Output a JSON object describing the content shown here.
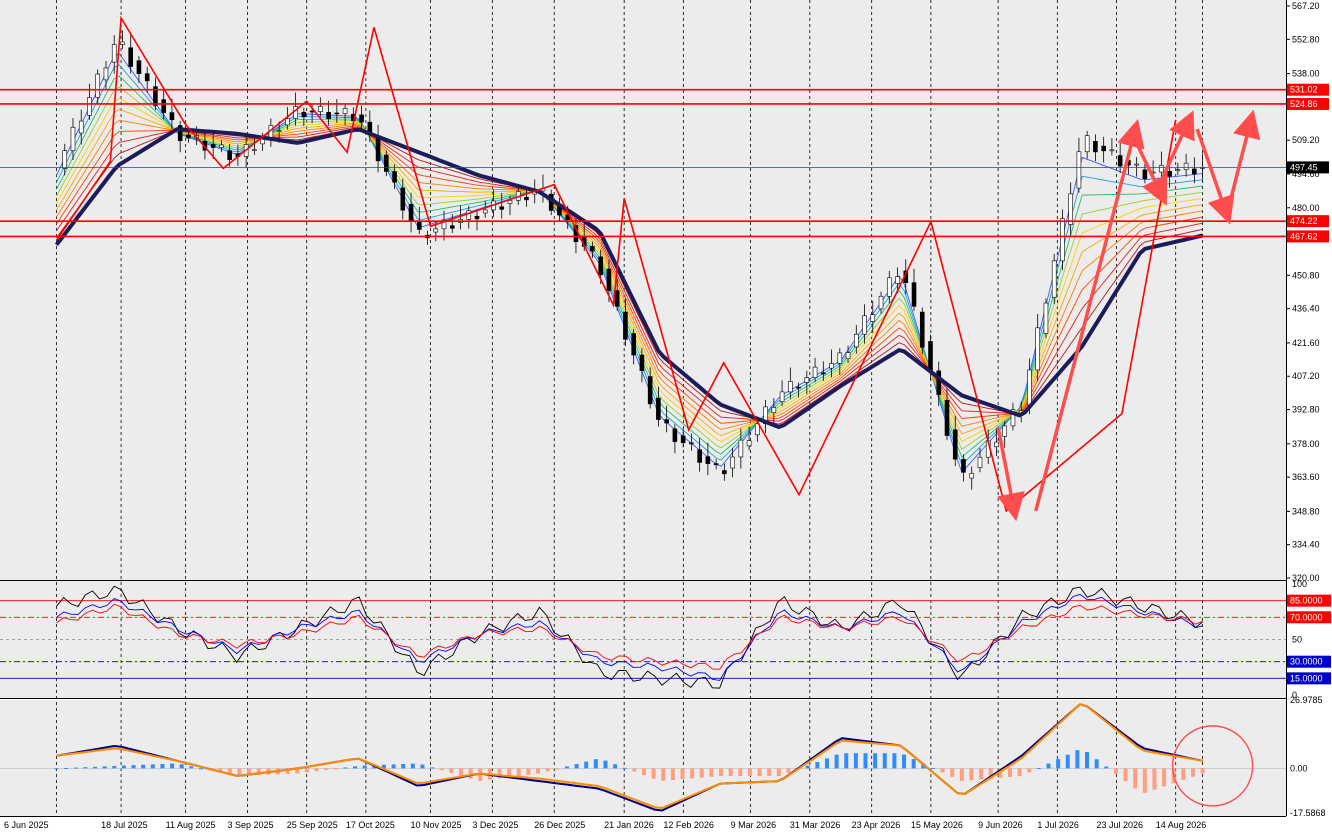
{
  "chart_data": [
    {
      "type": "candlestick",
      "panel": "price",
      "series": [
        {
          "name": "",
          "kind": "candles",
          "x": [
            "2025-06-24",
            "2025-07-18",
            "2025-08-11",
            "2025-09-03",
            "2025-09-25",
            "2025-10-17",
            "2025-11-10",
            "2025-12-03",
            "2025-12-26",
            "2026-01-21",
            "2026-02-12",
            "2026-03-09",
            "2026-03-31",
            "2026-04-23",
            "2026-05-15",
            "2026-06-09",
            "2026-07-01",
            "2026-07-23",
            "2026-08-14",
            "2026-08-24"
          ],
          "close": [
            497,
            553,
            512,
            502,
            522,
            520,
            468,
            478,
            488,
            455,
            387,
            365,
            400,
            415,
            455,
            362,
            395,
            510,
            495,
            497.45
          ]
        },
        {
          "name": "",
          "kind": "line",
          "color": "#1c1c5a",
          "values": [
            464,
            498,
            514,
            512,
            508,
            514,
            504,
            494,
            487,
            470,
            417,
            395,
            385,
            403,
            419,
            399,
            390,
            420,
            462,
            468
          ]
        }
      ],
      "xlabels": [
        "6 Jun 2025",
        "18 Jul 2025",
        "11 Aug 2025",
        "3 Sep 2025",
        "25 Sep 2025",
        "17 Oct 2025",
        "10 Nov 2025",
        "3 Dec 2025",
        "26 Dec 2025",
        "21 Jan 2026",
        "12 Feb 2026",
        "9 Mar 2026",
        "31 Mar 2026",
        "23 Apr 2026",
        "15 May 2026",
        "9 Jun 2026",
        "1 Jul 2026",
        "23 Jul 2026",
        "14 Aug 2026"
      ],
      "yticks": [
        "567.20",
        "552.80",
        "538.00",
        "509.20",
        "494.60",
        "480.00",
        "450.80",
        "436.40",
        "421.60",
        "407.20",
        "392.80",
        "378.00",
        "363.60",
        "348.80",
        "334.40",
        "320.00"
      ],
      "ylim": [
        320,
        567.2
      ],
      "hlines": [
        {
          "value": 531.02,
          "label": "531.02",
          "color": "#ff0000"
        },
        {
          "value": 524.86,
          "label": "524.86",
          "color": "#ff0000"
        },
        {
          "value": 497.45,
          "label": "497.45",
          "color": "#1f3fd0"
        },
        {
          "value": 474.22,
          "label": "474.22",
          "color": "#ff0000"
        },
        {
          "value": 467.62,
          "label": "467.62",
          "color": "#ff0000"
        }
      ],
      "zigzag": [
        {
          "x": "2025-06-24",
          "y": 466
        },
        {
          "x": "2025-07-14",
          "y": 500
        },
        {
          "x": "2025-07-18",
          "y": 562
        },
        {
          "x": "2025-08-11",
          "y": 516
        },
        {
          "x": "2025-08-25",
          "y": 497
        },
        {
          "x": "2025-09-25",
          "y": 526
        },
        {
          "x": "2025-10-10",
          "y": 504
        },
        {
          "x": "2025-10-20",
          "y": 558
        },
        {
          "x": "2025-11-10",
          "y": 472
        },
        {
          "x": "2025-12-26",
          "y": 490
        },
        {
          "x": "2026-01-17",
          "y": 438
        },
        {
          "x": "2026-01-21",
          "y": 484
        },
        {
          "x": "2026-02-14",
          "y": 384
        },
        {
          "x": "2026-02-27",
          "y": 413
        },
        {
          "x": "2026-03-27",
          "y": 356
        },
        {
          "x": "2026-05-15",
          "y": 474
        },
        {
          "x": "2026-06-12",
          "y": 349
        },
        {
          "x": "2026-07-25",
          "y": 391
        },
        {
          "x": "2026-08-14",
          "y": 518
        }
      ],
      "projection_arrows": [
        {
          "from": {
            "x": "2026-06-09",
            "y": 385
          },
          "to": {
            "x": "2026-06-15",
            "y": 349
          }
        },
        {
          "from": {
            "x": "2026-06-23",
            "y": 349
          },
          "to": {
            "x": "2026-07-30",
            "y": 514
          }
        },
        {
          "from": {
            "x": "2026-07-30",
            "y": 509
          },
          "to": {
            "x": "2026-08-09",
            "y": 485
          }
        },
        {
          "from": {
            "x": "2026-08-06",
            "y": 485
          },
          "to": {
            "x": "2026-08-19",
            "y": 518
          }
        },
        {
          "from": {
            "x": "2026-08-22",
            "y": 514
          },
          "to": {
            "x": "2026-09-02",
            "y": 477
          }
        },
        {
          "from": {
            "x": "2026-09-02",
            "y": 477
          },
          "to": {
            "x": "2026-09-11",
            "y": 518
          }
        }
      ]
    },
    {
      "type": "line",
      "panel": "oscillator",
      "ylim": [
        0,
        100
      ],
      "yticks": [
        "100",
        "50",
        "0"
      ],
      "levels": [
        {
          "value": 85,
          "label": "85.0000",
          "color": "#ff0000"
        },
        {
          "value": 70,
          "label": "70.0000",
          "color": "#ff0000"
        },
        {
          "value": 30,
          "label": "30.0000",
          "color": "#0000cc"
        },
        {
          "value": 15,
          "label": "15.0000",
          "color": "#0000cc"
        }
      ],
      "series": [
        {
          "name": "",
          "color": "#000000",
          "values": [
            80,
            95,
            60,
            35,
            60,
            85,
            20,
            55,
            75,
            20,
            15,
            10,
            85,
            60,
            85,
            15,
            70,
            95,
            80,
            65
          ]
        },
        {
          "name": "",
          "color": "#0000ff",
          "values": [
            70,
            85,
            60,
            40,
            60,
            75,
            30,
            55,
            65,
            30,
            25,
            15,
            75,
            60,
            75,
            20,
            65,
            90,
            75,
            62
          ]
        },
        {
          "name": "",
          "color": "#ff0000",
          "values": [
            65,
            80,
            55,
            45,
            55,
            70,
            35,
            55,
            60,
            35,
            30,
            25,
            70,
            60,
            70,
            30,
            60,
            80,
            72,
            66
          ]
        }
      ]
    },
    {
      "type": "bar",
      "panel": "macd",
      "ylim": [
        -17.5868,
        26.9785
      ],
      "yticks": [
        "26.9785",
        "0.00",
        "-17.5868"
      ],
      "histogram": [
        0,
        1,
        2,
        -3,
        -2,
        1,
        2,
        -5,
        -2,
        4,
        -5,
        -3,
        -3,
        6,
        6,
        -5,
        -3,
        8,
        -10,
        -2
      ],
      "series": [
        {
          "name": "",
          "color": "#000080",
          "values": [
            5,
            9,
            3,
            -3,
            0,
            4,
            -7,
            -2,
            -5,
            -8,
            -17,
            -6,
            -5,
            12,
            9,
            -11,
            5,
            26,
            8,
            3
          ]
        },
        {
          "name": "",
          "color": "#ff8c00",
          "values": [
            5,
            8,
            3,
            -3,
            0,
            4,
            -6,
            -2,
            -4,
            -7,
            -16,
            -6,
            -5,
            11,
            9,
            -11,
            4,
            26,
            7,
            3
          ]
        }
      ]
    }
  ]
}
